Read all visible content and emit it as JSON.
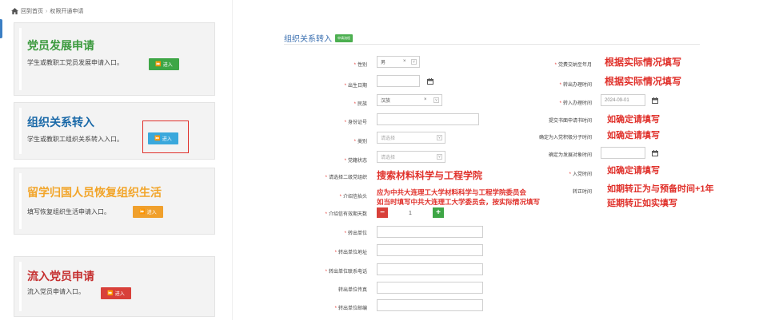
{
  "breadcrumb": {
    "home": "回到首页",
    "current": "权限开通申请"
  },
  "cards": [
    {
      "title": "党员发展申请",
      "desc": "学生或教职工党员发展申请入口。",
      "btn": "进入",
      "color": "#3c9a3e",
      "btn_color": "#3ea646"
    },
    {
      "title": "组织关系转入",
      "desc": "学生或教职工组织关系转入入口。",
      "btn": "进入",
      "color": "#1a69a8",
      "btn_color": "#3aa8dc"
    },
    {
      "title": "留学归国人员恢复组织生活",
      "desc": "填写恢复组织生活申请入口。",
      "btn": "进入",
      "color": "#f2a52a",
      "btn_color": "#f0a02c"
    },
    {
      "title": "流入党员申请",
      "desc": "流入党员申请入口。",
      "btn": "进入",
      "color": "#c53030",
      "btn_color": "#d8403a"
    }
  ],
  "form": {
    "title": "组织关系转入",
    "badge": "申请流程",
    "left_fields": [
      {
        "label": "性别",
        "required": true,
        "value": "男",
        "type": "select-clear"
      },
      {
        "label": "出生日期",
        "required": true,
        "value": "",
        "type": "date"
      },
      {
        "label": "民族",
        "required": true,
        "value": "汉族",
        "type": "select-clear"
      },
      {
        "label": "身份证号",
        "required": true,
        "value": "",
        "type": "text"
      },
      {
        "label": "类别",
        "required": true,
        "value": "请选择",
        "type": "select"
      },
      {
        "label": "党籍状态",
        "required": true,
        "value": "请选择",
        "type": "select"
      },
      {
        "label": "请选择二级党组织",
        "required": true,
        "value": "",
        "type": "none"
      },
      {
        "label": "介绍信抬头",
        "required": true,
        "value": "",
        "type": "none"
      },
      {
        "label": "介绍信有效期天数",
        "required": true,
        "value": "1",
        "type": "stepper"
      },
      {
        "label": "转出单位",
        "required": true,
        "value": "",
        "type": "text"
      },
      {
        "label": "转出单位地址",
        "required": true,
        "value": "",
        "type": "text"
      },
      {
        "label": "转出单位联系电话",
        "required": true,
        "value": "",
        "type": "text"
      },
      {
        "label": "转出单位传真",
        "required": false,
        "value": "",
        "type": "text"
      },
      {
        "label": "转出单位邮编",
        "required": true,
        "value": "",
        "type": "text"
      }
    ],
    "right_fields": [
      {
        "label": "党费交纳至年月",
        "required": true,
        "value": ""
      },
      {
        "label": "转出办理时间",
        "required": true,
        "value": ""
      },
      {
        "label": "转入办理时间",
        "required": true,
        "value": "2024-09-01"
      },
      {
        "label": "提交书面申请书时间",
        "required": false,
        "value": ""
      },
      {
        "label": "确定为入党积极分子时间",
        "required": false,
        "value": ""
      },
      {
        "label": "确定为发展对象时间",
        "required": false,
        "value": ""
      },
      {
        "label": "入党时间",
        "required": true,
        "value": ""
      },
      {
        "label": "转正时间",
        "required": false,
        "value": ""
      }
    ]
  },
  "annotations": {
    "a1": "根据实际情况填写",
    "a2": "根据实际情况填写",
    "a3": "如确定请填写",
    "a4": "如确定请填写",
    "a5": "如确定请填写",
    "a6": "如期转正为与预备时间+1年",
    "a7": "延期转正如实填写",
    "org": "搜索材料科学与工程学院",
    "letter1": "应为中共大连理工大学材料科学与工程学院委员会",
    "letter2": "如当时填写中共大连理工大学委员会，按实际情况填写"
  }
}
